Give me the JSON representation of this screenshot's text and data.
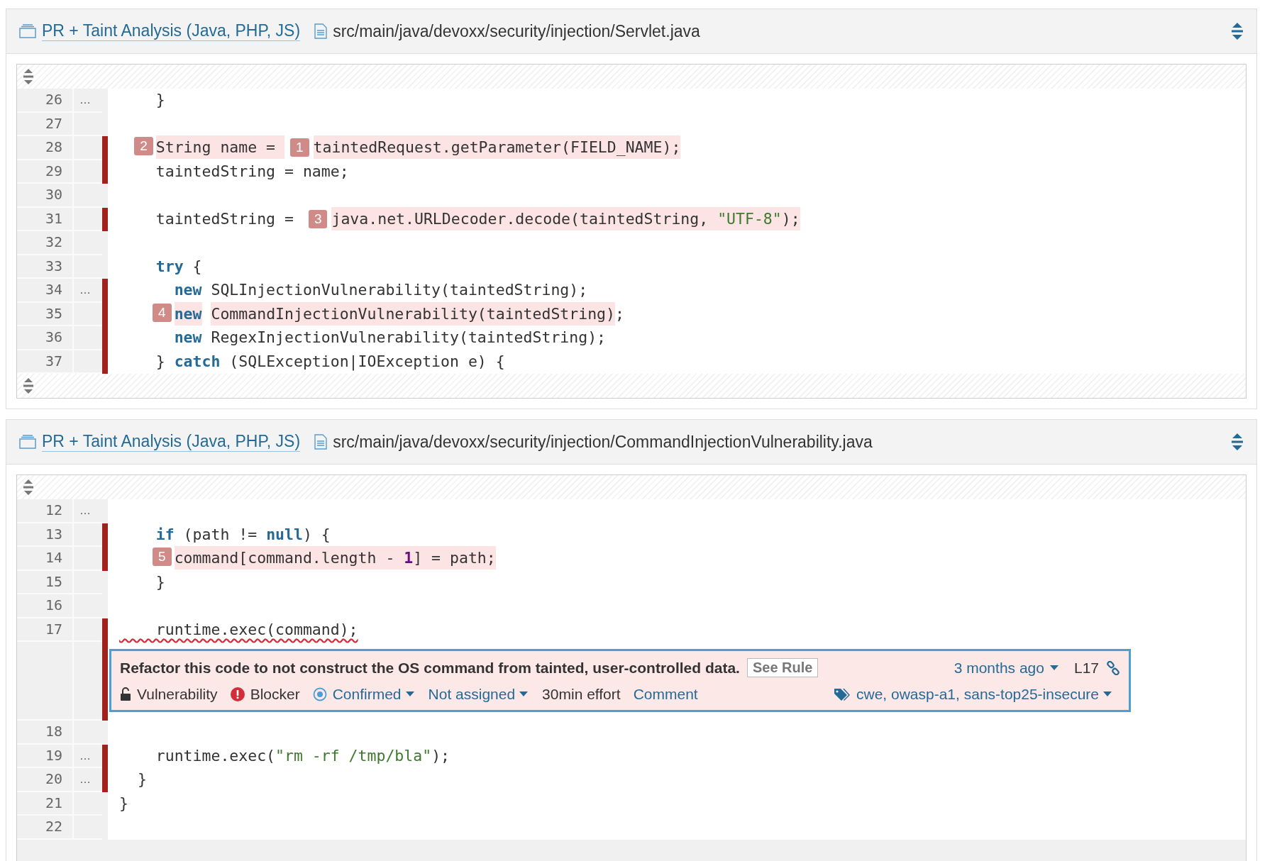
{
  "panels": [
    {
      "project": "PR + Taint Analysis (Java, PHP, JS)",
      "file": "src/main/java/devoxx/security/injection/Servlet.java",
      "expand_bottom": true,
      "lines": [
        {
          "number": "26",
          "more": "…",
          "marked": false,
          "parts": [
            {
              "kind": "plain",
              "text": "    }"
            }
          ]
        },
        {
          "number": "27",
          "marked": false
        },
        {
          "number": "28",
          "marked": true,
          "parts": [
            {
              "kind": "plain",
              "text": "    String name = ",
              "tainted": true,
              "step": "2"
            },
            {
              "kind": "plain",
              "text": "taintedRequest.getParameter(FIELD_NAME);",
              "tainted": true,
              "step": "1"
            }
          ]
        },
        {
          "number": "29",
          "marked": true,
          "parts": [
            {
              "kind": "plain",
              "text": "    taintedString = name;"
            }
          ]
        },
        {
          "number": "30",
          "marked": false
        },
        {
          "number": "31",
          "marked": true,
          "parts": [
            {
              "kind": "plain",
              "text": "    taintedString = "
            },
            {
              "kind": "plain",
              "text": "java.net.URLDecoder.decode(taintedString, ",
              "tainted": true,
              "step": "3"
            },
            {
              "kind": "string",
              "text": "\"UTF-8\"",
              "tainted": true
            },
            {
              "kind": "plain",
              "text": ");",
              "tainted": true
            }
          ]
        },
        {
          "number": "32",
          "marked": false
        },
        {
          "number": "33",
          "marked": false,
          "parts": [
            {
              "kind": "keyword",
              "text": "    try"
            },
            {
              "kind": "plain",
              "text": " {"
            }
          ]
        },
        {
          "number": "34",
          "more": "…",
          "marked": true,
          "parts": [
            {
              "kind": "keyword",
              "text": "      new"
            },
            {
              "kind": "plain",
              "text": " SQLInjectionVulnerability(taintedString);"
            }
          ]
        },
        {
          "number": "35",
          "marked": true,
          "parts": [
            {
              "kind": "keyword",
              "text": "      new",
              "tainted": true,
              "step": "4"
            },
            {
              "kind": "plain",
              "text": " CommandInjectionVulnerability(taintedString)",
              "tainted": true
            },
            {
              "kind": "plain",
              "text": ";"
            }
          ]
        },
        {
          "number": "36",
          "marked": true,
          "parts": [
            {
              "kind": "keyword",
              "text": "      new"
            },
            {
              "kind": "plain",
              "text": " RegexInjectionVulnerability(taintedString);"
            }
          ]
        },
        {
          "number": "37",
          "marked": true,
          "parts": [
            {
              "kind": "plain",
              "text": "    } "
            },
            {
              "kind": "keyword",
              "text": "catch"
            },
            {
              "kind": "plain",
              "text": " (SQLException|IOException e) {"
            }
          ]
        }
      ]
    },
    {
      "project": "PR + Taint Analysis (Java, PHP, JS)",
      "file": "src/main/java/devoxx/security/injection/CommandInjectionVulnerability.java",
      "expand_bottom": false,
      "lines": [
        {
          "number": "12",
          "more": "…",
          "marked": false
        },
        {
          "number": "13",
          "marked": true,
          "parts": [
            {
              "kind": "keyword",
              "text": "    if"
            },
            {
              "kind": "plain",
              "text": " (path != "
            },
            {
              "kind": "keyword",
              "text": "null"
            },
            {
              "kind": "plain",
              "text": ") {"
            }
          ]
        },
        {
          "number": "14",
          "marked": true,
          "parts": [
            {
              "kind": "plain",
              "text": "      command[command.length - ",
              "tainted": true,
              "step": "5"
            },
            {
              "kind": "number",
              "text": "1",
              "tainted": true
            },
            {
              "kind": "plain",
              "text": "] = path;",
              "tainted": true
            }
          ]
        },
        {
          "number": "15",
          "marked": false,
          "parts": [
            {
              "kind": "plain",
              "text": "    }"
            }
          ]
        },
        {
          "number": "16",
          "marked": false
        },
        {
          "number": "17",
          "marked": true,
          "parts": [
            {
              "kind": "error",
              "text": "    runtime.exec(command);"
            }
          ],
          "issue": {
            "message": "Refactor this code to not construct the OS command from tainted, user-controlled data.",
            "rule": "See Rule",
            "age": "3 months ago",
            "line": "L17",
            "type": "Vulnerability",
            "severity": "Blocker",
            "status": "Confirmed",
            "assignee": "Not assigned",
            "effort": "30min effort",
            "comment": "Comment",
            "tags": "cwe, owasp-a1, sans-top25-insecure"
          }
        },
        {
          "number": "18",
          "marked": false
        },
        {
          "number": "19",
          "more": "…",
          "marked": true,
          "parts": [
            {
              "kind": "plain",
              "text": "    runtime.exec("
            },
            {
              "kind": "string",
              "text": "\"rm -rf /tmp/bla\""
            },
            {
              "kind": "plain",
              "text": ");"
            }
          ]
        },
        {
          "number": "20",
          "more": "…",
          "marked": true,
          "parts": [
            {
              "kind": "plain",
              "text": "  }"
            }
          ]
        },
        {
          "number": "21",
          "marked": false,
          "parts": [
            {
              "kind": "plain",
              "text": "}"
            }
          ]
        },
        {
          "number": "22",
          "marked": false
        }
      ]
    }
  ]
}
